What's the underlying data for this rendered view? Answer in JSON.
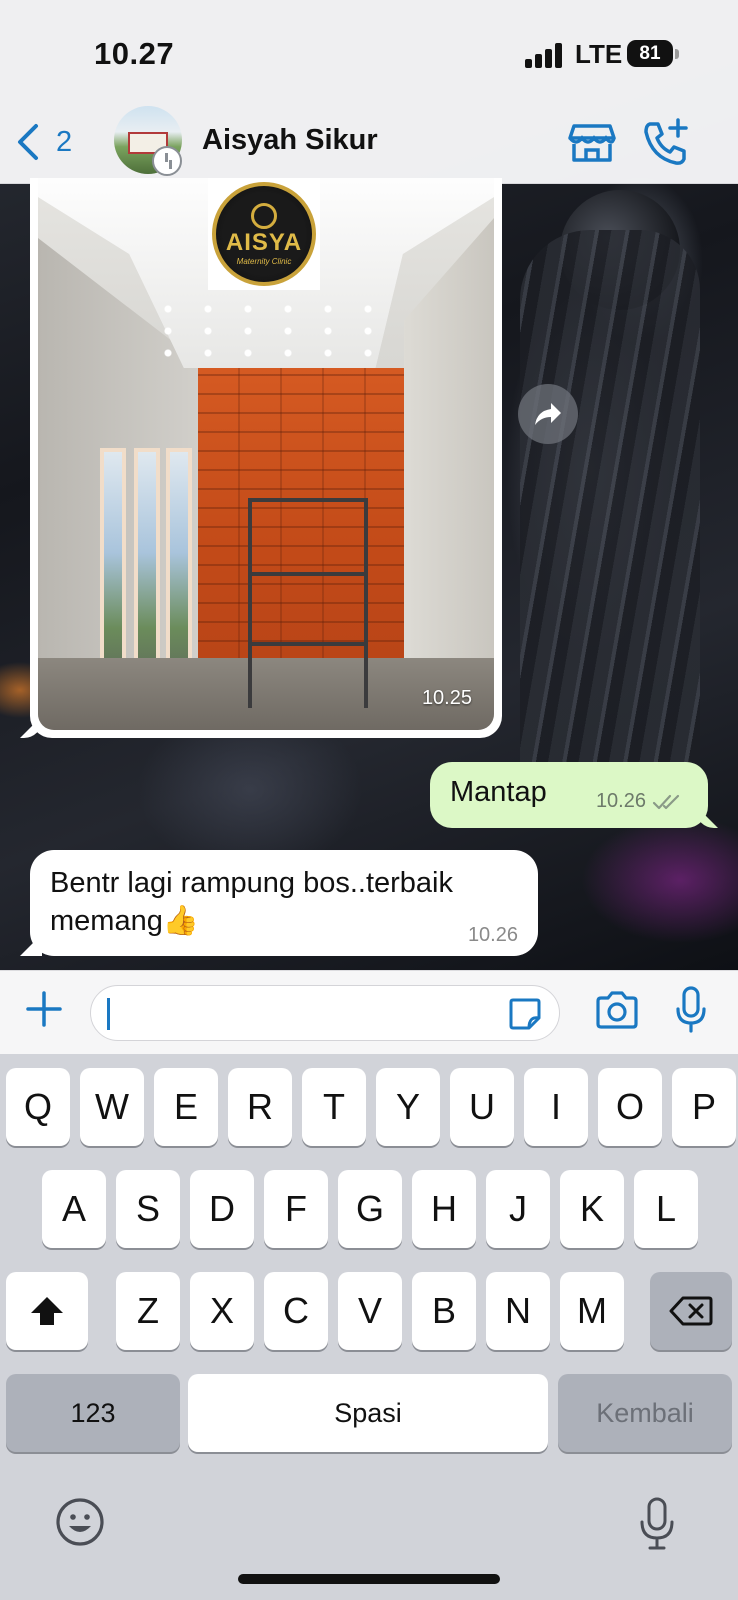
{
  "status_bar": {
    "time": "10.27",
    "network": "LTE",
    "battery": "81"
  },
  "header": {
    "back_count": "2",
    "contact_name": "Aisyah Sikur",
    "icons": [
      "back-chevron-icon",
      "store-icon",
      "add-call-icon"
    ]
  },
  "messages": [
    {
      "type": "image",
      "direction": "incoming",
      "logo_text": "AISYA",
      "logo_subtext": "Maternity Clinic",
      "time": "10.25"
    },
    {
      "type": "text",
      "direction": "outgoing",
      "text": "Mantap",
      "time": "10.26",
      "read_receipt": "double-check-icon"
    },
    {
      "type": "text",
      "direction": "incoming",
      "text": "Bentr lagi rampung bos..terbaik memang👍",
      "time": "10.26"
    }
  ],
  "input_bar": {
    "value": "",
    "icons": [
      "plus-icon",
      "sticker-icon",
      "camera-icon",
      "microphone-icon"
    ]
  },
  "keyboard": {
    "row1": [
      "Q",
      "W",
      "E",
      "R",
      "T",
      "Y",
      "U",
      "I",
      "O",
      "P"
    ],
    "row2": [
      "A",
      "S",
      "D",
      "F",
      "G",
      "H",
      "J",
      "K",
      "L"
    ],
    "row3": [
      "Z",
      "X",
      "C",
      "V",
      "B",
      "N",
      "M"
    ],
    "numbers_key": "123",
    "space_key": "Spasi",
    "return_key": "Kembali",
    "icons": [
      "shift-icon",
      "backspace-icon",
      "emoji-icon",
      "dictation-mic-icon"
    ]
  },
  "colors": {
    "accent": "#1a78c2",
    "outgoing_bubble": "#dcf8c6",
    "incoming_bubble": "#ffffff",
    "keyboard_bg": "#d1d3d9"
  }
}
